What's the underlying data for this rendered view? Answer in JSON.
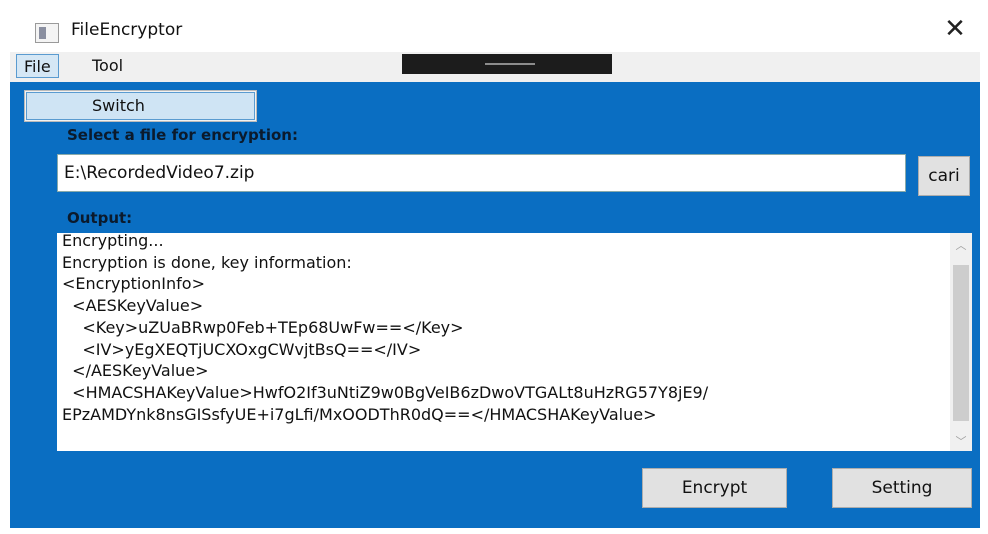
{
  "window": {
    "title": "FileEncryptor",
    "close_glyph": "✕"
  },
  "menubar": {
    "items": [
      "File",
      "Tool"
    ]
  },
  "dropdown": {
    "items": [
      "Switch"
    ]
  },
  "form": {
    "file_label": "Select a file for encryption:",
    "file_path": "E:\\RecordedVideo7.zip",
    "browse_label": "cari",
    "output_label": "Output:"
  },
  "output_lines": [
    "Encrypting...",
    "Encryption is done, key information:",
    "<EncryptionInfo>",
    "  <AESKeyValue>",
    "    <Key>uZUaBRwp0Feb+TEp68UwFw==</Key>",
    "    <IV>yEgXEQTjUCXOxgCWvjtBsQ==</IV>",
    "  </AESKeyValue>",
    "  <HMACSHAKeyValue>HwfO2If3uNtiZ9w0BgVeIB6zDwoVTGALt8uHzRG57Y8jE9/",
    "EPzAMDYnk8nsGISsfyUE+i7gLfi/MxOODThR0dQ==</HMACSHAKeyValue>"
  ],
  "buttons": {
    "encrypt": "Encrypt",
    "setting": "Setting"
  },
  "colors": {
    "content_bg": "#0a6ec2",
    "menu_highlight": "#d5e7f5"
  },
  "icons": {
    "app": "app-window-icon",
    "close": "close-icon",
    "scroll_up": "chevron-up-icon",
    "scroll_down": "chevron-down-icon"
  }
}
